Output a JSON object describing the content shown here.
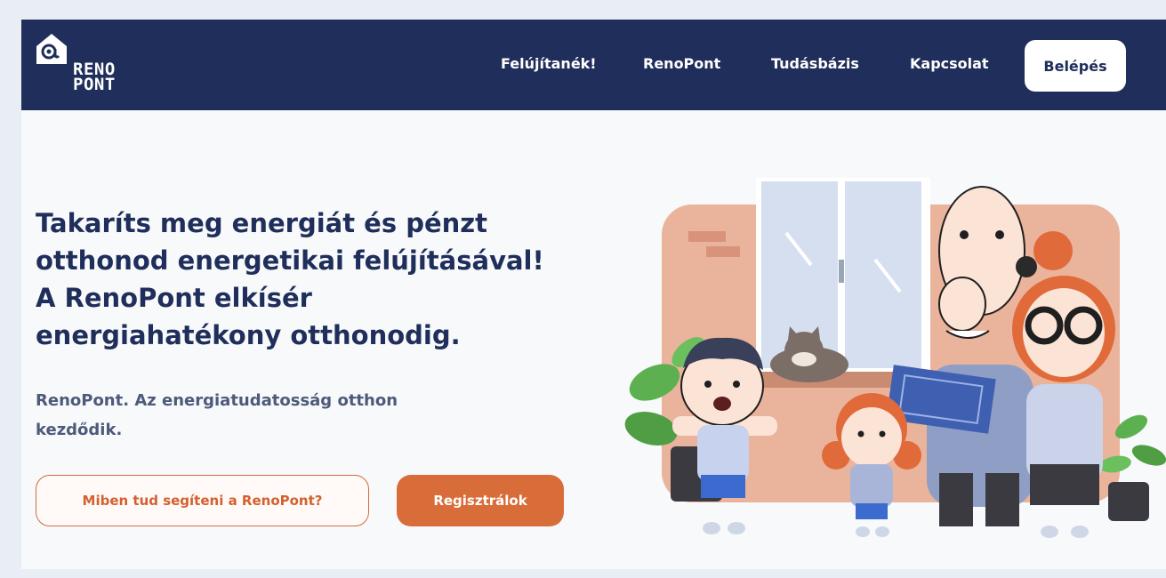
{
  "brand": {
    "logo_line1": "RENO",
    "logo_line2": "PONT",
    "navy": "#1f2e5a",
    "orange": "#d96d3a"
  },
  "nav": {
    "links": [
      "Felújítanék!",
      "RenoPont",
      "Tudásbázis",
      "Kapcsolat"
    ],
    "login_label": "Belépés"
  },
  "hero": {
    "headline_lines": [
      "Takaríts meg energiát és pénzt",
      "otthonod energetikai felújításával!",
      "A RenoPont elkísér",
      "energiahatékony otthonodig."
    ],
    "tagline_lines": [
      "RenoPont. Az energiatudatosság otthon",
      "kezdődik."
    ],
    "secondary_button": "Miben tud segíteni a RenoPont?",
    "primary_button": "Regisztrálok"
  },
  "illustration": {
    "icon": "family-house-illustration"
  }
}
